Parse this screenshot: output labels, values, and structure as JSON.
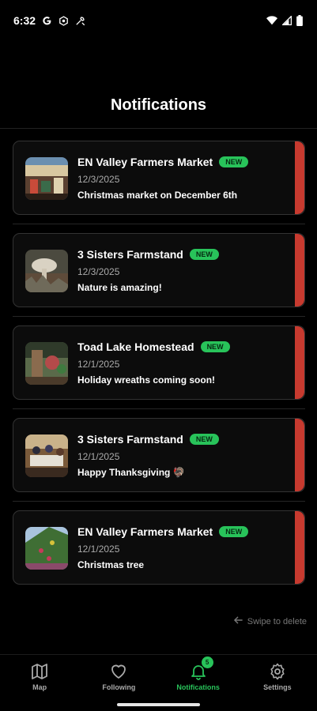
{
  "status_bar": {
    "time": "6:32",
    "left_icons": [
      "google-g-icon",
      "settings-gear-icon",
      "tools-icon"
    ],
    "right_icons": [
      "wifi-icon",
      "cell-signal-icon",
      "battery-icon"
    ]
  },
  "page": {
    "title": "Notifications"
  },
  "notifications": [
    {
      "name": "EN Valley Farmers Market",
      "badge": "NEW",
      "date": "12/3/2025",
      "message": "Christmas market on December 6th"
    },
    {
      "name": "3 Sisters Farmstand",
      "badge": "NEW",
      "date": "12/3/2025",
      "message": "Nature is amazing!"
    },
    {
      "name": "Toad Lake Homestead",
      "badge": "NEW",
      "date": "12/1/2025",
      "message": "Holiday wreaths coming soon!"
    },
    {
      "name": "3 Sisters Farmstand",
      "badge": "NEW",
      "date": "12/1/2025",
      "message": "Happy Thanksgiving 🦃"
    },
    {
      "name": "EN Valley Farmers Market",
      "badge": "NEW",
      "date": "12/1/2025",
      "message": "Christmas tree"
    }
  ],
  "hint": {
    "swipe_text": "Swipe to delete"
  },
  "bottom_nav": {
    "items": [
      {
        "label": "Map",
        "icon": "map-icon"
      },
      {
        "label": "Following",
        "icon": "heart-icon"
      },
      {
        "label": "Notifications",
        "icon": "bell-icon",
        "count": "5",
        "active": true
      },
      {
        "label": "Settings",
        "icon": "gear-icon"
      }
    ]
  },
  "colors": {
    "accent_green": "#28c35a",
    "accent_red": "#c73a2f",
    "background": "#000000"
  }
}
